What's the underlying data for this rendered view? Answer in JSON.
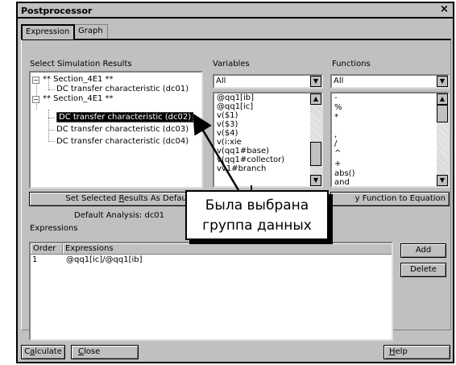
{
  "window": {
    "title": "Postprocessor",
    "close_glyph": "×"
  },
  "tabs": [
    {
      "label": "Expression",
      "active": true
    },
    {
      "label": "Graph",
      "active": false
    }
  ],
  "results": {
    "label": "Select Simulation Results",
    "tree": [
      {
        "text": "** Section_4E1 **",
        "expander": "−"
      },
      {
        "text": "DC transfer characteristic (dc01)"
      },
      {
        "text": "** Section_4E1 **",
        "expander": "−"
      },
      {
        "text": "DC transfer characteristic (dc02)",
        "selected": true
      },
      {
        "text": "DC transfer characteristic (dc03)"
      },
      {
        "text": "DC transfer characteristic (dc04)"
      }
    ],
    "set_default_prefix": "Set Selected ",
    "set_default_underline": "R",
    "set_default_suffix": "esults As Default",
    "default_analysis": "Default Analysis: dc01"
  },
  "variables": {
    "label": "Variables",
    "filter": "All",
    "items": [
      "@qq1[ib]",
      "@qq1[ic]",
      "v($1)",
      "v($3)",
      "v($4)",
      "v(i:xie",
      "v(qq1#base)",
      "v(qq1#collector)",
      "vv1#branch"
    ]
  },
  "functions": {
    "label": "Functions",
    "filter": "All",
    "items": [
      "-",
      "%",
      "*",
      "",
      ",",
      "/",
      "^",
      "+",
      "abs()",
      "and"
    ],
    "add_to_equation_visible": "y Function to Equation",
    "add_to_equation_underline": "F"
  },
  "expressions": {
    "label": "Expressions",
    "columns": [
      "Order",
      "Expressions"
    ],
    "rows": [
      {
        "order": "1",
        "expression": "@qq1[ic]/@qq1[ib]"
      }
    ],
    "add_label": "Add",
    "delete_label": "Delete"
  },
  "footer": {
    "calculate_pre": "C",
    "calculate_ul": "a",
    "calculate_post": "lculate",
    "close_ul": "C",
    "close_post": "lose",
    "help_ul": "H",
    "help_post": "elp"
  },
  "callout": {
    "line1": "Была выбрана",
    "line2": "группа данных"
  }
}
